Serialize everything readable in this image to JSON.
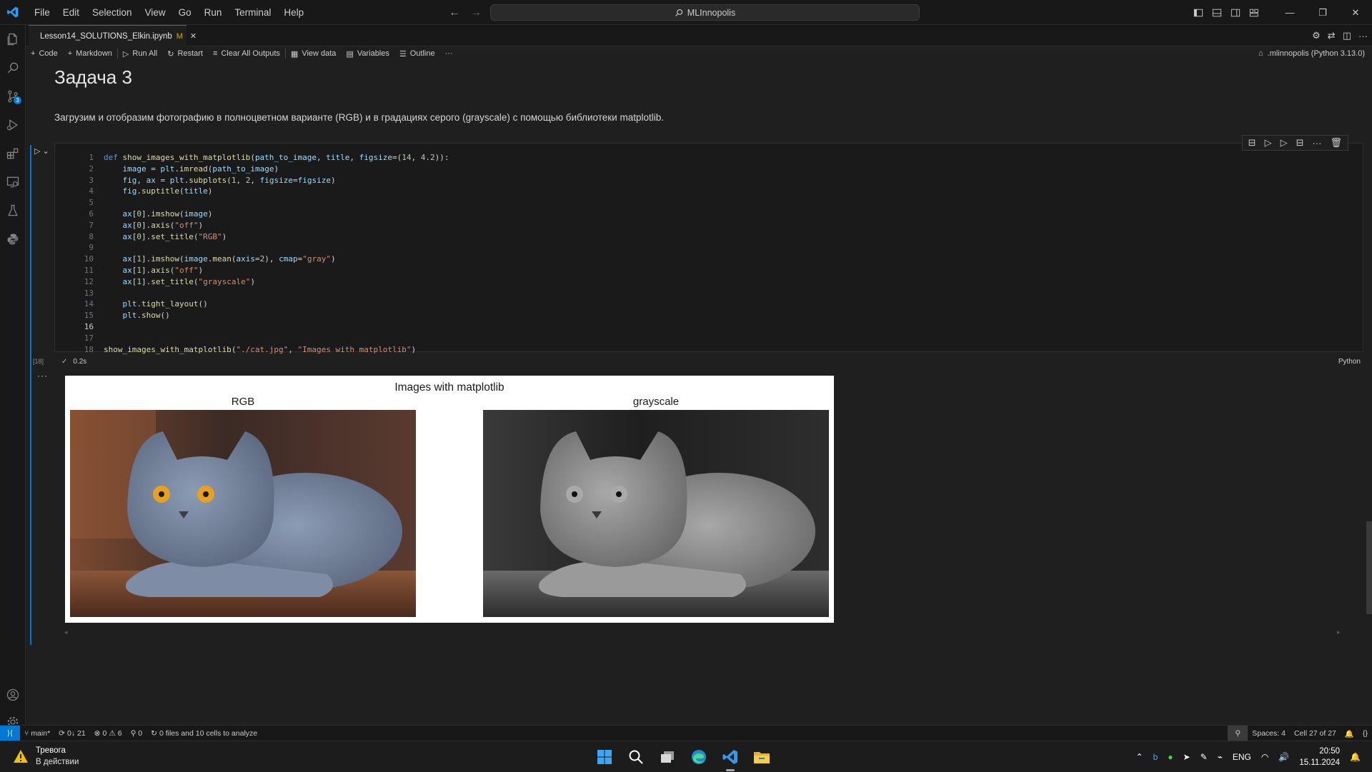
{
  "menu": [
    "File",
    "Edit",
    "Selection",
    "View",
    "Go",
    "Run",
    "Terminal",
    "Help"
  ],
  "search": {
    "text": "MLInnopolis"
  },
  "tab": {
    "name": "Lesson14_SOLUTIONS_Elkin.ipynb",
    "modified": "M"
  },
  "toolbar": {
    "code": "Code",
    "markdown": "Markdown",
    "run_all": "Run All",
    "restart": "Restart",
    "clear_all_outputs": "Clear All Outputs",
    "view_data": "View data",
    "variables": "Variables",
    "outline": "Outline",
    "more": "···",
    "kernel": ".mlinnopolis (Python 3.13.0)"
  },
  "activity_badge": "3",
  "notebook": {
    "heading": "Задача 3",
    "paragraph": "Загрузим и отобразим фотографию в полноцветном варианте (RGB) и в градациях серого (grayscale) с помощью библиотеки matplotlib.",
    "exec_count": "[18]",
    "exec_time": "0.2s",
    "language": "Python",
    "output_dots": "···",
    "figure": {
      "suptitle": "Images with matplotlib",
      "left_title": "RGB",
      "right_title": "grayscale"
    }
  },
  "code_lines": [
    [
      [
        "kw",
        "def "
      ],
      [
        "fn",
        "show_images_with_matplotlib"
      ],
      [
        "tx",
        "("
      ],
      [
        "vr",
        "path_to_image"
      ],
      [
        "tx",
        ", "
      ],
      [
        "vr",
        "title"
      ],
      [
        "tx",
        ", "
      ],
      [
        "vr",
        "figsize"
      ],
      [
        "tx",
        "=("
      ],
      [
        "nm",
        "14"
      ],
      [
        "tx",
        ", "
      ],
      [
        "nm",
        "4.2"
      ],
      [
        "tx",
        "))"
      ],
      [
        "tx",
        ":"
      ]
    ],
    [
      [
        "tx",
        "    "
      ],
      [
        "vr",
        "image"
      ],
      [
        "tx",
        " = "
      ],
      [
        "vr",
        "plt"
      ],
      [
        "tx",
        "."
      ],
      [
        "fn",
        "imread"
      ],
      [
        "tx",
        "("
      ],
      [
        "vr",
        "path_to_image"
      ],
      [
        "tx",
        ")"
      ]
    ],
    [
      [
        "tx",
        "    "
      ],
      [
        "vr",
        "fig"
      ],
      [
        "tx",
        ", "
      ],
      [
        "vr",
        "ax"
      ],
      [
        "tx",
        " = "
      ],
      [
        "vr",
        "plt"
      ],
      [
        "tx",
        "."
      ],
      [
        "fn",
        "subplots"
      ],
      [
        "tx",
        "("
      ],
      [
        "nm",
        "1"
      ],
      [
        "tx",
        ", "
      ],
      [
        "nm",
        "2"
      ],
      [
        "tx",
        ", "
      ],
      [
        "vr",
        "figsize"
      ],
      [
        "tx",
        "="
      ],
      [
        "vr",
        "figsize"
      ],
      [
        "tx",
        ")"
      ]
    ],
    [
      [
        "tx",
        "    "
      ],
      [
        "vr",
        "fig"
      ],
      [
        "tx",
        "."
      ],
      [
        "fn",
        "suptitle"
      ],
      [
        "tx",
        "("
      ],
      [
        "vr",
        "title"
      ],
      [
        "tx",
        ")"
      ]
    ],
    [],
    [
      [
        "tx",
        "    "
      ],
      [
        "vr",
        "ax"
      ],
      [
        "tx",
        "["
      ],
      [
        "nm",
        "0"
      ],
      [
        "tx",
        "]."
      ],
      [
        "fn",
        "imshow"
      ],
      [
        "tx",
        "("
      ],
      [
        "vr",
        "image"
      ],
      [
        "tx",
        ")"
      ]
    ],
    [
      [
        "tx",
        "    "
      ],
      [
        "vr",
        "ax"
      ],
      [
        "tx",
        "["
      ],
      [
        "nm",
        "0"
      ],
      [
        "tx",
        "]."
      ],
      [
        "fn",
        "axis"
      ],
      [
        "tx",
        "("
      ],
      [
        "st",
        "\"off\""
      ],
      [
        "tx",
        ")"
      ]
    ],
    [
      [
        "tx",
        "    "
      ],
      [
        "vr",
        "ax"
      ],
      [
        "tx",
        "["
      ],
      [
        "nm",
        "0"
      ],
      [
        "tx",
        "]."
      ],
      [
        "fn",
        "set_title"
      ],
      [
        "tx",
        "("
      ],
      [
        "st",
        "\"RGB\""
      ],
      [
        "tx",
        ")"
      ]
    ],
    [],
    [
      [
        "tx",
        "    "
      ],
      [
        "vr",
        "ax"
      ],
      [
        "tx",
        "["
      ],
      [
        "nm",
        "1"
      ],
      [
        "tx",
        "]."
      ],
      [
        "fn",
        "imshow"
      ],
      [
        "tx",
        "("
      ],
      [
        "vr",
        "image"
      ],
      [
        "tx",
        "."
      ],
      [
        "fn",
        "mean"
      ],
      [
        "tx",
        "("
      ],
      [
        "vr",
        "axis"
      ],
      [
        "tx",
        "="
      ],
      [
        "nm",
        "2"
      ],
      [
        "tx",
        "), "
      ],
      [
        "vr",
        "cmap"
      ],
      [
        "tx",
        "="
      ],
      [
        "st",
        "\"gray\""
      ],
      [
        "tx",
        ")"
      ]
    ],
    [
      [
        "tx",
        "    "
      ],
      [
        "vr",
        "ax"
      ],
      [
        "tx",
        "["
      ],
      [
        "nm",
        "1"
      ],
      [
        "tx",
        "]."
      ],
      [
        "fn",
        "axis"
      ],
      [
        "tx",
        "("
      ],
      [
        "st",
        "\"off\""
      ],
      [
        "tx",
        ")"
      ]
    ],
    [
      [
        "tx",
        "    "
      ],
      [
        "vr",
        "ax"
      ],
      [
        "tx",
        "["
      ],
      [
        "nm",
        "1"
      ],
      [
        "tx",
        "]."
      ],
      [
        "fn",
        "set_title"
      ],
      [
        "tx",
        "("
      ],
      [
        "st",
        "\"grayscale\""
      ],
      [
        "tx",
        ")"
      ]
    ],
    [],
    [
      [
        "tx",
        "    "
      ],
      [
        "vr",
        "plt"
      ],
      [
        "tx",
        "."
      ],
      [
        "fn",
        "tight_layout"
      ],
      [
        "tx",
        "()"
      ]
    ],
    [
      [
        "tx",
        "    "
      ],
      [
        "vr",
        "plt"
      ],
      [
        "tx",
        "."
      ],
      [
        "fn",
        "show"
      ],
      [
        "tx",
        "()"
      ]
    ],
    [],
    [],
    [
      [
        "fn",
        "show_images_with_matplotlib"
      ],
      [
        "tx",
        "("
      ],
      [
        "st",
        "\"./cat.jpg\""
      ],
      [
        "tx",
        ", "
      ],
      [
        "st",
        "\"Images with matplotlib\""
      ],
      [
        "tx",
        ")"
      ]
    ]
  ],
  "status": {
    "branch": "main*",
    "sync": "0↓ 21",
    "errors": "0",
    "warnings": "6",
    "ports": "0",
    "analyze": "0 files and 10 cells to analyze",
    "spaces": "Spaces: 4",
    "cell": "Cell 27 of 27"
  },
  "taskbar": {
    "alert_title": "Тревога",
    "alert_sub": "В действии",
    "lang": "ENG",
    "time": "20:50",
    "date": "15.11.2024"
  }
}
